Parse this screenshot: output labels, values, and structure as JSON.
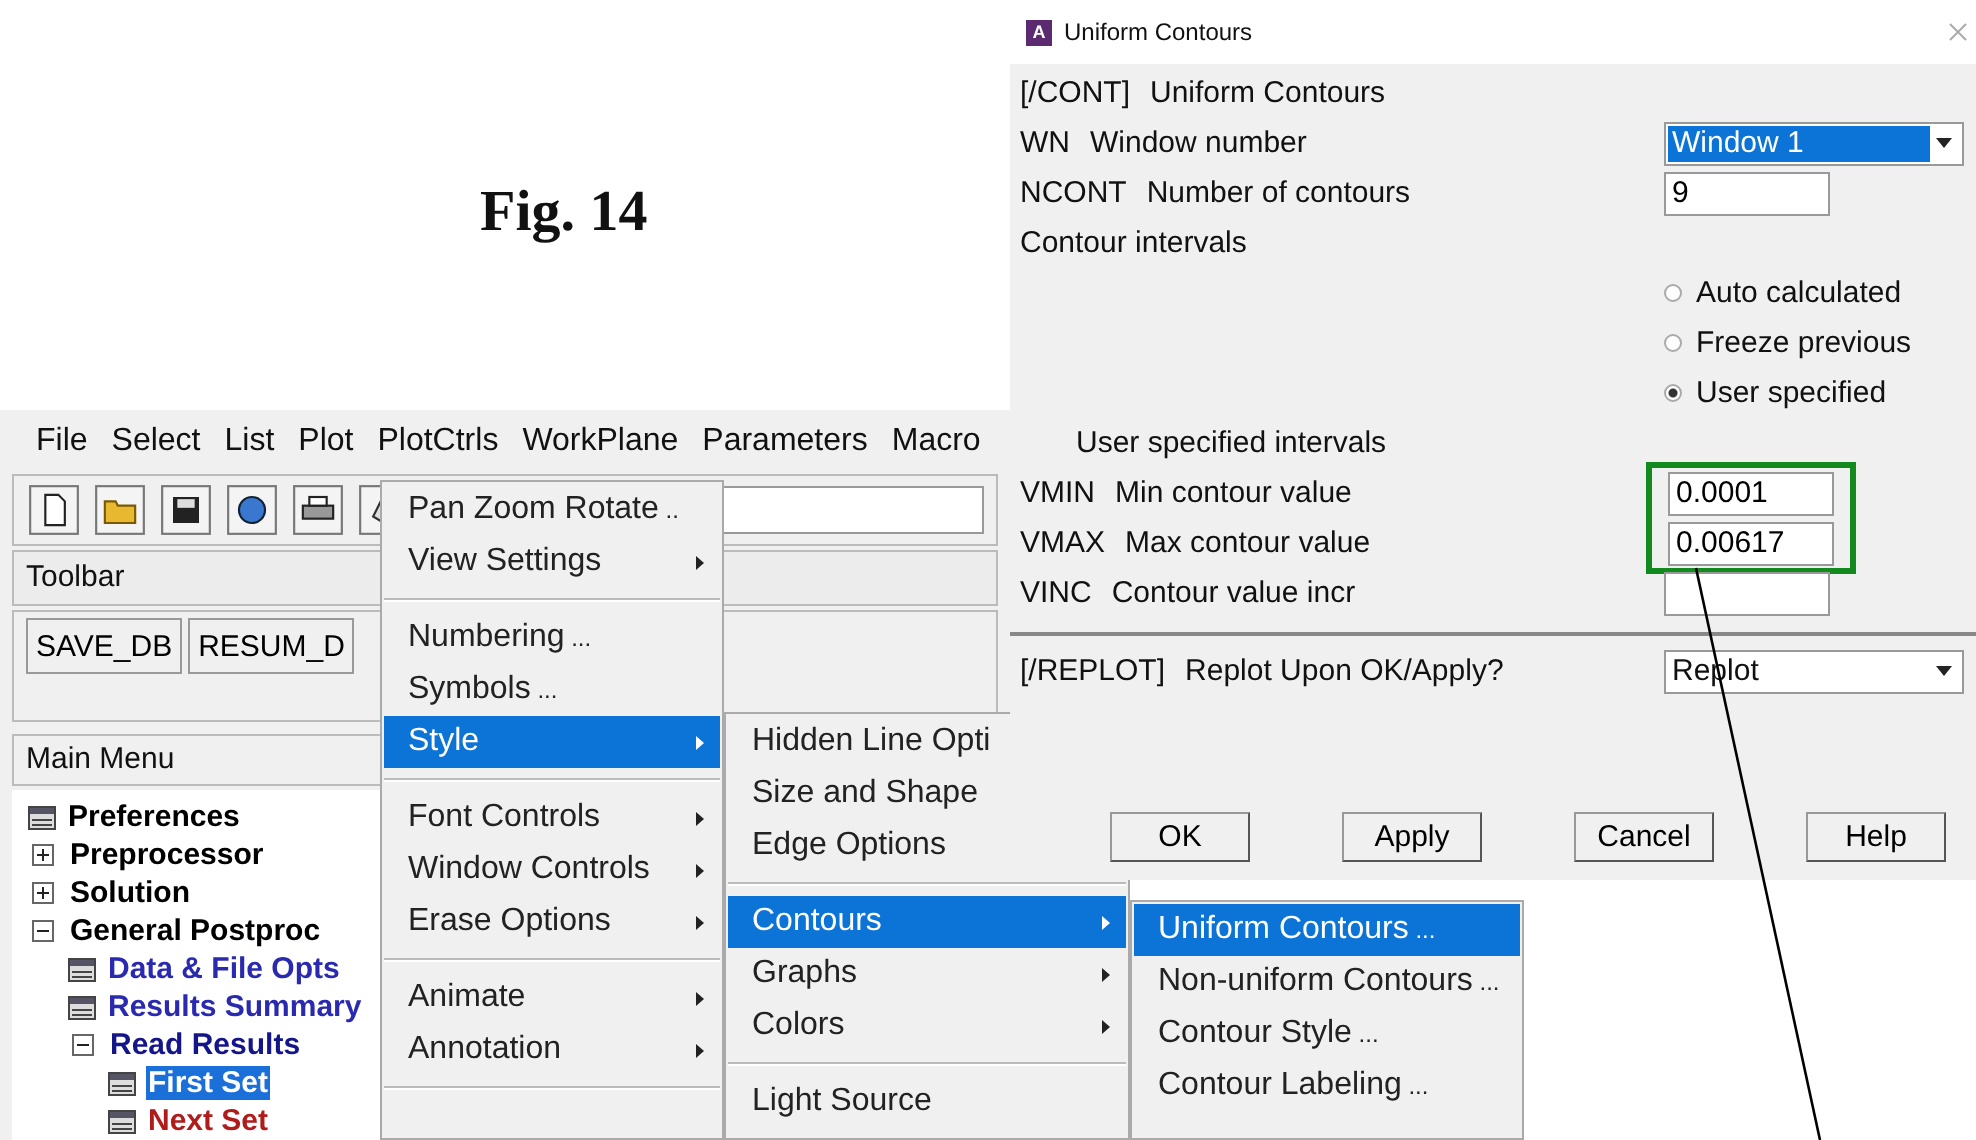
{
  "caption": "Fig. 14",
  "main_window": {
    "menu_bar": [
      "File",
      "Select",
      "List",
      "Plot",
      "PlotCtrls",
      "WorkPlane",
      "Parameters",
      "Macro"
    ],
    "toolbar_label": "Toolbar",
    "toolbar_buttons": [
      "SAVE_DB",
      "RESUM_D"
    ],
    "main_menu_title": "Main Menu",
    "tree": [
      {
        "label": "Preferences",
        "kind": "command",
        "selected": false,
        "color": "#000000"
      },
      {
        "label": "Preprocessor",
        "kind": "folder",
        "expanded": false,
        "selected": false,
        "color": "#000000"
      },
      {
        "label": "Solution",
        "kind": "folder",
        "expanded": false,
        "selected": false,
        "color": "#000000"
      },
      {
        "label": "General Postproc",
        "kind": "folder",
        "expanded": true,
        "selected": false,
        "color": "#000000",
        "children": [
          {
            "label": "Data & File Opts",
            "kind": "command",
            "selected": false,
            "color": "#2a2ab0"
          },
          {
            "label": "Results Summary",
            "kind": "command",
            "selected": false,
            "color": "#2a2ab0"
          },
          {
            "label": "Read Results",
            "kind": "folder",
            "expanded": true,
            "selected": false,
            "color": "#15158a",
            "children": [
              {
                "label": "First Set",
                "kind": "command",
                "selected": true
              },
              {
                "label": "Next Set",
                "kind": "command",
                "selected": false,
                "color": "#b01c1c"
              }
            ]
          }
        ]
      }
    ]
  },
  "plotctrls_menu": [
    {
      "kind": "item",
      "label": "Pan Zoom Rotate",
      "suffix": "..",
      "submenu": false,
      "selected": false
    },
    {
      "kind": "item",
      "label": "View Settings",
      "submenu": true,
      "selected": false
    },
    {
      "kind": "separator"
    },
    {
      "kind": "item",
      "label": "Numbering",
      "suffix": "...",
      "submenu": false,
      "selected": false
    },
    {
      "kind": "item",
      "label": "Symbols",
      "suffix": "...",
      "submenu": false,
      "selected": false
    },
    {
      "kind": "item",
      "label": "Style",
      "submenu": true,
      "selected": true
    },
    {
      "kind": "separator"
    },
    {
      "kind": "item",
      "label": "Font Controls",
      "submenu": true,
      "selected": false
    },
    {
      "kind": "item",
      "label": "Window Controls",
      "submenu": true,
      "selected": false
    },
    {
      "kind": "item",
      "label": "Erase Options",
      "submenu": true,
      "selected": false
    },
    {
      "kind": "separator"
    },
    {
      "kind": "item",
      "label": "Animate",
      "submenu": true,
      "selected": false
    },
    {
      "kind": "item",
      "label": "Annotation",
      "submenu": true,
      "selected": false
    },
    {
      "kind": "separator"
    }
  ],
  "style_menu": [
    {
      "kind": "item",
      "label": "Hidden Line Opti",
      "submenu": false,
      "selected": false
    },
    {
      "kind": "item",
      "label": "Size and Shape",
      "submenu": false,
      "selected": false
    },
    {
      "kind": "item",
      "label": "Edge Options",
      "submenu": false,
      "selected": false
    },
    {
      "kind": "separator"
    },
    {
      "kind": "item",
      "label": "Contours",
      "submenu": true,
      "selected": true
    },
    {
      "kind": "item",
      "label": "Graphs",
      "submenu": true,
      "selected": false
    },
    {
      "kind": "item",
      "label": "Colors",
      "submenu": true,
      "selected": false
    },
    {
      "kind": "separator"
    },
    {
      "kind": "item",
      "label": "Light Source",
      "submenu": false,
      "selected": false
    }
  ],
  "contours_menu": [
    {
      "kind": "item",
      "label": "Uniform Contours",
      "suffix": "...",
      "submenu": false,
      "selected": true
    },
    {
      "kind": "item",
      "label": "Non-uniform Contours",
      "suffix": "...",
      "submenu": false,
      "selected": false
    },
    {
      "kind": "item",
      "label": "Contour Style",
      "suffix": "...",
      "submenu": false,
      "selected": false
    },
    {
      "kind": "item",
      "label": "Contour Labeling",
      "suffix": "...",
      "submenu": false,
      "selected": false
    }
  ],
  "dialog": {
    "app_icon": "A",
    "title": "Uniform Contours",
    "rows": [
      {
        "kind": "heading",
        "code": "[/CONT]",
        "label": "Uniform Contours"
      },
      {
        "kind": "dropdown",
        "code": "WN",
        "label": "Window number",
        "value": "Window 1",
        "focused": true
      },
      {
        "kind": "input",
        "code": "NCONT",
        "label": "Number of contours",
        "value": "9"
      },
      {
        "kind": "heading",
        "label": "Contour intervals"
      },
      {
        "kind": "radio",
        "label": "Auto calculated",
        "selected": false
      },
      {
        "kind": "radio",
        "label": "Freeze previous",
        "selected": false
      },
      {
        "kind": "radio",
        "label": "User specified",
        "selected": true
      },
      {
        "kind": "subheading",
        "label": "User specified intervals"
      },
      {
        "kind": "group",
        "highlighted": true,
        "rows": [
          {
            "kind": "input",
            "code": "VMIN",
            "label": "Min contour value",
            "value": "0.0001"
          },
          {
            "kind": "input",
            "code": "VMAX",
            "label": "Max contour value",
            "value": "0.00617"
          }
        ]
      },
      {
        "kind": "input",
        "code": "VINC",
        "label": "Contour value incr",
        "value": ""
      },
      {
        "kind": "separator"
      },
      {
        "kind": "dropdown",
        "code": "[/REPLOT]",
        "label": "Replot Upon OK/Apply?",
        "value": "Replot",
        "focused": false
      }
    ],
    "buttons": [
      "OK",
      "Apply",
      "Cancel",
      "Help"
    ]
  }
}
